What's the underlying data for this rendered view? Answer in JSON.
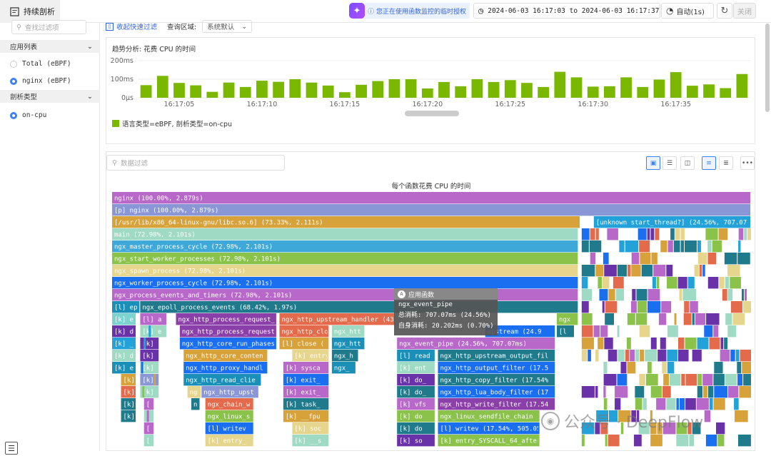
{
  "topbar": {
    "tab_label": "持续剖析",
    "ai_icon": "sparkle-icon",
    "auth_text": "您正在使用函数监控的临时授权",
    "time_range": "2024-06-03 16:17:03 to 2024-06-03 16:17:37",
    "auto_refresh": "自动(1s)",
    "close_label": "关闭"
  },
  "sidebar": {
    "filter_placeholder": "查找过滤项",
    "app_list_title": "应用列表",
    "apps": [
      {
        "label": "Total (eBPF)",
        "selected": false
      },
      {
        "label": "nginx (eBPF)",
        "selected": true
      }
    ],
    "profile_type_title": "剖析类型",
    "profile_types": [
      {
        "label": "on-cpu",
        "selected": true
      }
    ]
  },
  "query_bar": {
    "collapse_label": "收起快速过滤",
    "query_area_label": "查询区域:",
    "query_area_value": "系统默认"
  },
  "trend": {
    "title": "趋势分析: 花费 CPU 的时间",
    "legend": "语言类型=eBPF, 剖析类型=on-cpu",
    "legend_color": "#7ab800"
  },
  "chart_data": {
    "type": "bar",
    "title": "趋势分析: 花费 CPU 的时间",
    "ylim": [
      0,
      200
    ],
    "ytick_labels": [
      "0μs",
      "100ms",
      "200ms"
    ],
    "xtick_labels": [
      "16:17:05",
      "16:17:10",
      "16:17:15",
      "16:17:20",
      "16:17:25",
      "16:17:30",
      "16:17:35"
    ],
    "categories": [
      "16:17:03",
      "16:17:04",
      "16:17:05",
      "16:17:06",
      "16:17:07",
      "16:17:08",
      "16:17:09",
      "16:17:10",
      "16:17:11",
      "16:17:12",
      "16:17:13",
      "16:17:14",
      "16:17:15",
      "16:17:16",
      "16:17:17",
      "16:17:18",
      "16:17:19",
      "16:17:20",
      "16:17:21",
      "16:17:22",
      "16:17:23",
      "16:17:24",
      "16:17:25",
      "16:17:26",
      "16:17:27",
      "16:17:28",
      "16:17:29",
      "16:17:30",
      "16:17:31",
      "16:17:32",
      "16:17:33",
      "16:17:34",
      "16:17:35",
      "16:17:36",
      "16:17:37"
    ],
    "values": [
      68,
      118,
      80,
      67,
      32,
      82,
      58,
      92,
      86,
      100,
      82,
      66,
      30,
      70,
      90,
      100,
      100,
      50,
      85,
      62,
      100,
      85,
      95,
      80,
      58,
      140,
      110,
      60,
      62,
      110,
      58,
      98,
      138,
      65,
      72,
      52,
      128
    ],
    "series": [
      {
        "name": "语言类型=eBPF, 剖析类型=on-cpu",
        "color": "#7ab800"
      }
    ]
  },
  "flame": {
    "filter_placeholder": "数据过滤",
    "title": "每个函数花费 CPU 的时间",
    "more_icon": "more-icon",
    "frames": [
      {
        "label": "nginx (100.00%, 2.879s)",
        "row": 0,
        "start": 0,
        "end": 100,
        "color": "#b868c9"
      },
      {
        "label": "[p] nginx (100.00%, 2.879s)",
        "row": 1,
        "start": 0,
        "end": 100,
        "color": "#8a97d6"
      },
      {
        "label": "[/usr/lib/x86_64-linux-gnu/libc.so.6] (73.33%, 2.111s)",
        "row": 2,
        "start": 0,
        "end": 73.3,
        "color": "#d8a23a"
      },
      {
        "label": "[unknown start_thread?] (24.56%, 707.07",
        "row": 2,
        "start": 75.4,
        "end": 100,
        "color": "#22a2d8"
      },
      {
        "label": "main (72.98%, 2.101s)",
        "row": 3,
        "start": 0,
        "end": 73,
        "color": "#9fdac5"
      },
      {
        "label": "ngx_master_process_cycle (72.98%, 2.101s)",
        "row": 4,
        "start": 0,
        "end": 73,
        "color": "#3ea9d8"
      },
      {
        "label": "ngx_start_worker_processes (72.98%, 2.101s)",
        "row": 5,
        "start": 0,
        "end": 73,
        "color": "#8ac24a"
      },
      {
        "label": "ngx_spawn_process (72.98%, 2.101s)",
        "row": 6,
        "start": 0,
        "end": 73,
        "color": "#e6d58c"
      },
      {
        "label": "ngx_worker_process_cycle (72.98%, 2.101s)",
        "row": 7,
        "start": 0,
        "end": 73,
        "color": "#1a6ef0"
      },
      {
        "label": "ngx_process_events_and_timers (72.98%, 2.101s)",
        "row": 8,
        "start": 0,
        "end": 73,
        "color": "#b868c9"
      },
      {
        "label": "[l] ep",
        "row": 9,
        "start": 0,
        "end": 4.4,
        "color": "#1a8fb8"
      },
      {
        "label": "ngx_epoll_process_events (68.42%, 1.97s)",
        "row": 9,
        "start": 4.4,
        "end": 73,
        "color": "#1f7a8c"
      },
      {
        "label": "[k] e",
        "row": 10,
        "start": 0,
        "end": 3.8,
        "color": "#7bd4d0"
      },
      {
        "label": "[l] a",
        "row": 10,
        "start": 4.4,
        "end": 8.6,
        "color": "#b868c9"
      },
      {
        "label": "ngx_http_process_request_",
        "row": 10,
        "start": 10,
        "end": 25.8,
        "color": "#8b3fa8"
      },
      {
        "label": "ngx_http_upstream_handler (43",
        "row": 10,
        "start": 26.2,
        "end": 44.4,
        "color": "#e36a4a"
      },
      {
        "label": "ngx",
        "row": 10,
        "start": 69.6,
        "end": 73,
        "color": "#8ac24a"
      },
      {
        "label": "[k] d",
        "row": 11,
        "start": 0,
        "end": 3.8,
        "color": "#6a32a8"
      },
      {
        "label": "[k] e",
        "row": 11,
        "start": 4.4,
        "end": 8.6,
        "color": "#9fdac5"
      },
      {
        "label": "ngx_http_process_request",
        "row": 11,
        "start": 10.6,
        "end": 25.8,
        "color": "#8b3fa8"
      },
      {
        "label": "ngx_http_clo",
        "row": 11,
        "start": 26.2,
        "end": 34,
        "color": "#e36a4a"
      },
      {
        "label": "ngx_htt",
        "row": 11,
        "start": 34.4,
        "end": 39.6,
        "color": "#9fdac5"
      },
      {
        "label": "upstream (24.9",
        "row": 11,
        "start": 58.4,
        "end": 69.4,
        "color": "#1a6ef0"
      },
      {
        "label": "[l",
        "row": 11,
        "start": 69.6,
        "end": 72.4,
        "color": "#1f7a8c"
      },
      {
        "label": "[k] _",
        "row": 12,
        "start": 0,
        "end": 3.8,
        "color": "#22a2d8"
      },
      {
        "label": "[k]",
        "row": 12,
        "start": 4.4,
        "end": 7.4,
        "color": "#6a32a8"
      },
      {
        "label": "ngx_http_core_run_phases",
        "row": 12,
        "start": 10.6,
        "end": 25.8,
        "color": "#1a6ef0"
      },
      {
        "label": "[l] close (",
        "row": 12,
        "start": 26.2,
        "end": 34,
        "color": "#d8a23a"
      },
      {
        "label": "ngx_htt",
        "row": 12,
        "start": 34.4,
        "end": 39.6,
        "color": "#1a8fb8"
      },
      {
        "label": "ngx_event_pipe (24.56%, 707.07ms)",
        "row": 12,
        "start": 44.6,
        "end": 69.4,
        "color": "#b868c9"
      },
      {
        "label": "[k] d",
        "row": 13,
        "start": 0,
        "end": 3.8,
        "color": "#9fdac5"
      },
      {
        "label": "[k]",
        "row": 13,
        "start": 4.4,
        "end": 7.4,
        "color": "#6a32a8"
      },
      {
        "label": "ngx_http_core_conten",
        "row": 13,
        "start": 11.2,
        "end": 24.4,
        "color": "#d8a23a"
      },
      {
        "label": "[k] entry_S",
        "row": 13,
        "start": 28.2,
        "end": 34,
        "color": "#e6d58c"
      },
      {
        "label": "ngx_h",
        "row": 13,
        "start": 34.4,
        "end": 38.6,
        "color": "#1f7a8c"
      },
      {
        "label": "[l] read",
        "row": 13,
        "start": 44.6,
        "end": 50.6,
        "color": "#1a8fb8"
      },
      {
        "label": "ngx_http_upstream_output_fil",
        "row": 13,
        "start": 51,
        "end": 69.4,
        "color": "#1f7a8c"
      },
      {
        "label": "[k] e",
        "row": 14,
        "start": 0,
        "end": 3.8,
        "color": "#1a8fb8"
      },
      {
        "label": "[k]",
        "row": 14,
        "start": 4.4,
        "end": 7.4,
        "color": "#9fdac5"
      },
      {
        "label": "ngx_http_proxy_handl",
        "row": 14,
        "start": 11.2,
        "end": 24.4,
        "color": "#1a6ef0"
      },
      {
        "label": "[k] sysca",
        "row": 14,
        "start": 26.8,
        "end": 34,
        "color": "#b868c9"
      },
      {
        "label": "ngx_",
        "row": 14,
        "start": 34.4,
        "end": 38.2,
        "color": "#1a8fb8"
      },
      {
        "label": "[k] ent",
        "row": 14,
        "start": 44.6,
        "end": 50.6,
        "color": "#9fdac5"
      },
      {
        "label": "ngx_http_output_filter (17.5",
        "row": 14,
        "start": 51,
        "end": 69.4,
        "color": "#1a6ef0"
      },
      {
        "label": "[k]",
        "row": 15,
        "start": 1.4,
        "end": 3.8,
        "color": "#d8a23a"
      },
      {
        "label": "[k]",
        "row": 15,
        "start": 4.4,
        "end": 7.4,
        "color": "#8a97d6"
      },
      {
        "label": "ngx_http_read_clie",
        "row": 15,
        "start": 11.2,
        "end": 23.4,
        "color": "#1a8fb8"
      },
      {
        "label": "[k] exit_",
        "row": 15,
        "start": 26.8,
        "end": 34,
        "color": "#1a6ef0"
      },
      {
        "label": "[k] do_",
        "row": 15,
        "start": 44.6,
        "end": 50.6,
        "color": "#6a32a8"
      },
      {
        "label": "ngx_http_copy_filter (17.54%",
        "row": 15,
        "start": 51,
        "end": 69.4,
        "color": "#1f7a8c"
      },
      {
        "label": "[k]",
        "row": 16,
        "start": 1.4,
        "end": 3.8,
        "color": "#e36a4a"
      },
      {
        "label": "[k]",
        "row": 16,
        "start": 4.4,
        "end": 7.4,
        "color": "#9fdac5"
      },
      {
        "label": "ng",
        "row": 16,
        "start": 11.8,
        "end": 14,
        "color": "#e6d58c"
      },
      {
        "label": "ngx_http_upst",
        "row": 16,
        "start": 14,
        "end": 23,
        "color": "#8a97d6"
      },
      {
        "label": "[k] exit_",
        "row": 16,
        "start": 26.8,
        "end": 34,
        "color": "#b868c9"
      },
      {
        "label": "[k] do_",
        "row": 16,
        "start": 44.6,
        "end": 50.6,
        "color": "#1f7a8c"
      },
      {
        "label": "ngx_http_lua_body_filter (17",
        "row": 16,
        "start": 51,
        "end": 69.4,
        "color": "#1a6ef0"
      },
      {
        "label": "[k]",
        "row": 17,
        "start": 1.4,
        "end": 3.8,
        "color": "#1f7a8c"
      },
      {
        "label": "[",
        "row": 17,
        "start": 5,
        "end": 6.6,
        "color": "#b868c9"
      },
      {
        "label": "n",
        "row": 17,
        "start": 12.4,
        "end": 13.8,
        "color": "#1f7a8c"
      },
      {
        "label": "ngx_chain_w",
        "row": 17,
        "start": 14.6,
        "end": 22.2,
        "color": "#e36a4a"
      },
      {
        "label": "[k] task_",
        "row": 17,
        "start": 26.8,
        "end": 34,
        "color": "#1f7a8c"
      },
      {
        "label": "[k] vfs",
        "row": 17,
        "start": 44.6,
        "end": 50.6,
        "color": "#b868c9"
      },
      {
        "label": "ngx_http_write_filter (17.54",
        "row": 17,
        "start": 51,
        "end": 69.4,
        "color": "#8b3fa8"
      },
      {
        "label": "[k]",
        "row": 18,
        "start": 1.4,
        "end": 3.8,
        "color": "#1f7a8c"
      },
      {
        "label": "[",
        "row": 18,
        "start": 5,
        "end": 6.6,
        "color": "#9fdac5"
      },
      {
        "label": "ngx_linux_s",
        "row": 18,
        "start": 14.6,
        "end": 22.2,
        "color": "#8ac24a"
      },
      {
        "label": "[k] __fpu",
        "row": 18,
        "start": 26.8,
        "end": 34,
        "color": "#d8a23a"
      },
      {
        "label": "[k] do",
        "row": 18,
        "start": 44.6,
        "end": 50.6,
        "color": "#8ac24a"
      },
      {
        "label": "ngx_linux_sendfile_chain",
        "row": 18,
        "start": 51,
        "end": 67,
        "color": "#8ac24a"
      },
      {
        "label": "[",
        "row": 19,
        "start": 5,
        "end": 6.6,
        "color": "#b868c9"
      },
      {
        "label": "[l] writev",
        "row": 19,
        "start": 14.6,
        "end": 22.2,
        "color": "#1a6ef0"
      },
      {
        "label": "[k] soc",
        "row": 19,
        "start": 28.2,
        "end": 34,
        "color": "#e6d58c"
      },
      {
        "label": "[k] do",
        "row": 19,
        "start": 44.6,
        "end": 50.6,
        "color": "#1f7a8c"
      },
      {
        "label": "[l] writev (17.54%, 505.05m",
        "row": 19,
        "start": 51,
        "end": 67,
        "color": "#1a6ef0"
      },
      {
        "label": "[",
        "row": 20,
        "start": 5,
        "end": 6.6,
        "color": "#9fdac5"
      },
      {
        "label": "[k] entry_",
        "row": 20,
        "start": 14.6,
        "end": 22.2,
        "color": "#e6d58c"
      },
      {
        "label": "[k] __s",
        "row": 20,
        "start": 28.2,
        "end": 34,
        "color": "#9fdac5"
      },
      {
        "label": "[k] so",
        "row": 20,
        "start": 44.6,
        "end": 50.6,
        "color": "#6a32a8"
      },
      {
        "label": "[k] entry_SYSCALL_64_after_h",
        "row": 20,
        "start": 51,
        "end": 67,
        "color": "#8ac24a"
      }
    ]
  },
  "tooltip": {
    "header": "应用函数",
    "func": "ngx_event_pipe",
    "total": "总消耗: 707.07ms (24.56%)",
    "self": "自身消耗: 20.202ms (0.70%)"
  },
  "watermark": "公众号 · DeepFlow"
}
